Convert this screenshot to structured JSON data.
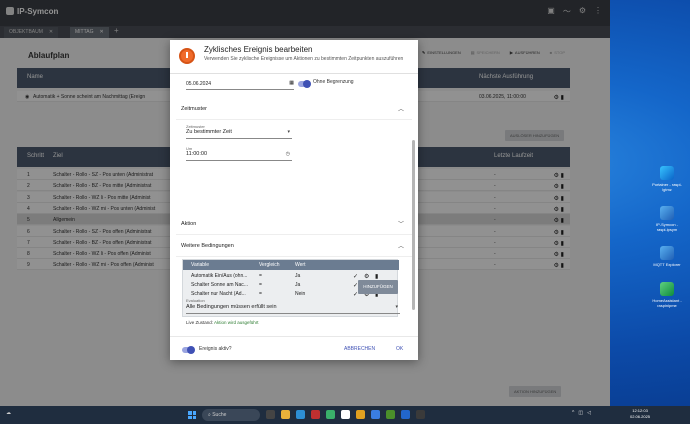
{
  "app": {
    "name": "IP-Symcon",
    "tabs": [
      {
        "label": "OBJEKTBAUM",
        "close": "✕"
      },
      {
        "label": "MITTAG",
        "close": "✕"
      }
    ],
    "add_tab": "+"
  },
  "plan": {
    "title": "Ablaufplan",
    "toolbar": [
      "EINSTELLUNGEN",
      "SPEICHERN",
      "AUSFÜHREN",
      "STOP"
    ],
    "events_header": {
      "name": "Name",
      "next": "Nächste Ausführung"
    },
    "event_row": {
      "name": "Automatik + Sonne scheint am Nachmittag (Ereign",
      "next": "03.06.2025, 11:00:00"
    },
    "add_trigger": "AUSLÖSER HINZUFÜGEN",
    "steps_header": {
      "step": "Schritt",
      "goal": "Ziel",
      "last": "Letzte Laufzeit"
    },
    "steps": [
      {
        "n": "1",
        "goal": "Schalter - Rollo - SZ - Pos unten (Administrat",
        "last": "-"
      },
      {
        "n": "2",
        "goal": "Schalter - Rollo - BZ - Pos mitte (Administrat",
        "last": "-"
      },
      {
        "n": "3",
        "goal": "Schalter - Rollo - WZ li - Pos mitte (Administ",
        "last": "-"
      },
      {
        "n": "4",
        "goal": "Schalter - Rollo - WZ mi - Pos unten (Administ",
        "last": "-"
      },
      {
        "n": "5",
        "goal": "Allgemein",
        "last": "-"
      },
      {
        "n": "6",
        "goal": "Schalter - Rollo - SZ - Pos offen (Administrat",
        "last": "-"
      },
      {
        "n": "7",
        "goal": "Schalter - Rollo - BZ - Pos offen (Administrat",
        "last": "-"
      },
      {
        "n": "8",
        "goal": "Schalter - Rollo - WZ li - Pos offen (Administ",
        "last": "-"
      },
      {
        "n": "9",
        "goal": "Schalter - Rollo - WZ mi - Pos offen (Administ",
        "last": "-"
      }
    ],
    "add_action": "AKTION HINZUFÜGEN"
  },
  "dialog": {
    "title": "Zyklisches Ereignis bearbeiten",
    "subtitle": "Verwenden Sie zyklische Ereignisse um Aktionen zu bestimmten Zeitpunkten auszuführen",
    "date_value": "05.06.2024",
    "no_limit": "Ohne Begrenzung",
    "zeitmuster": {
      "title": "Zeitmuster",
      "pattern_label": "Zeitmuster",
      "pattern_value": "Zu bestimmter Zeit",
      "time_label": "Um",
      "time_value": "11:00:00"
    },
    "aktion_title": "Aktion",
    "conditions": {
      "title": "Weitere Bedingungen",
      "headers": {
        "var": "Variable",
        "cmp": "Vergleich",
        "val": "Wert"
      },
      "rows": [
        {
          "var": "Automatik Ein/Aus (ohn...",
          "cmp": "=",
          "val": "Ja"
        },
        {
          "var": "Schalter Sonne am Nac...",
          "cmp": "=",
          "val": "Ja"
        },
        {
          "var": "Schalter nur Nacht (Ad...",
          "cmp": "=",
          "val": "Nein"
        }
      ],
      "add_button": "HINZUFÜGEN",
      "evaluation_label": "Evaluation",
      "evaluation_value": "Alle Bedingungen müssen erfüllt sein",
      "live_label": "Live Zustand:",
      "live_value": "Aktion wird ausgeführt"
    },
    "active_label": "Ereignis aktiv?",
    "cancel": "ABBRECHEN",
    "ok": "OK"
  },
  "desktop": {
    "icons": [
      {
        "label": "Portainer - raspi-lgtmz"
      },
      {
        "label": "IP-Symcon - raspi-ipsym"
      },
      {
        "label": "MQTT Explorer"
      },
      {
        "label": "HomeAssistant - raspinipme"
      }
    ]
  },
  "taskbar": {
    "search": "Suche",
    "time": "12:12:03",
    "date": "02.06.2025"
  }
}
